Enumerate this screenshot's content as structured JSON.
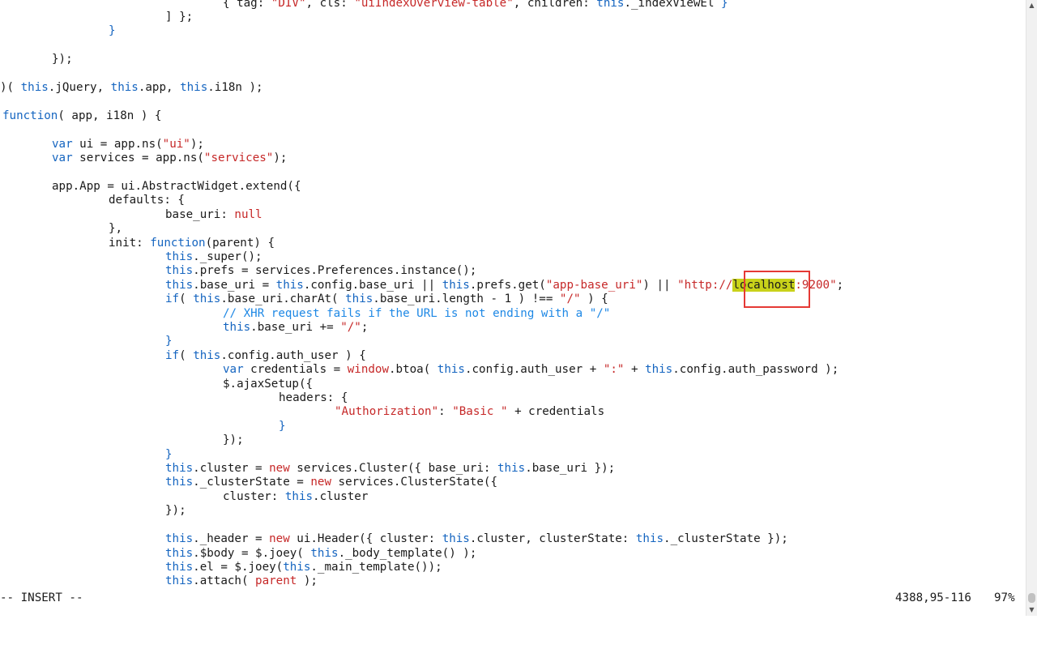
{
  "editor": {
    "lines": [
      [
        {
          "t": "{ tag: ",
          "c": "pl"
        },
        {
          "t": "\"DIV\"",
          "c": "str"
        },
        {
          "t": ", cls: ",
          "c": "pl"
        },
        {
          "t": "\"uiIndexOverview-table\"",
          "c": "str"
        },
        {
          "t": ", children: ",
          "c": "pl"
        },
        {
          "t": "this",
          "c": "kw"
        },
        {
          "t": "._indexViewEl ",
          "c": "pl"
        },
        {
          "t": "}",
          "c": "kw"
        }
      ],
      [
        {
          "t": "] };",
          "c": "pl"
        }
      ],
      [
        {
          "t": "}",
          "c": "kw"
        }
      ],
      [],
      [
        {
          "t": "});",
          "c": "pl"
        }
      ],
      [],
      [
        {
          "t": ")( ",
          "c": "pl"
        },
        {
          "t": "this",
          "c": "kw"
        },
        {
          "t": ".jQuery, ",
          "c": "pl"
        },
        {
          "t": "this",
          "c": "kw"
        },
        {
          "t": ".app, ",
          "c": "pl"
        },
        {
          "t": "this",
          "c": "kw"
        },
        {
          "t": ".i18n );",
          "c": "pl"
        }
      ],
      [],
      [
        {
          "t": "function",
          "c": "kw"
        },
        {
          "t": "( app, i18n ) {",
          "c": "pl"
        }
      ],
      [],
      [
        {
          "t": "var",
          "c": "kw"
        },
        {
          "t": " ui = app.ns(",
          "c": "pl"
        },
        {
          "t": "\"ui\"",
          "c": "str"
        },
        {
          "t": ");",
          "c": "pl"
        }
      ],
      [
        {
          "t": "var",
          "c": "kw"
        },
        {
          "t": " services = app.ns(",
          "c": "pl"
        },
        {
          "t": "\"services\"",
          "c": "str"
        },
        {
          "t": ");",
          "c": "pl"
        }
      ],
      [],
      [
        {
          "t": "app.App = ui.AbstractWidget.extend({",
          "c": "pl"
        }
      ],
      [
        {
          "t": "defaults: {",
          "c": "pl"
        }
      ],
      [
        {
          "t": "base_uri: ",
          "c": "pl"
        },
        {
          "t": "null",
          "c": "str"
        }
      ],
      [
        {
          "t": "},",
          "c": "pl"
        }
      ],
      [
        {
          "t": "init: ",
          "c": "pl"
        },
        {
          "t": "function",
          "c": "kw"
        },
        {
          "t": "(parent) {",
          "c": "pl"
        }
      ],
      [
        {
          "t": "this",
          "c": "kw"
        },
        {
          "t": "._super();",
          "c": "pl"
        }
      ],
      [
        {
          "t": "this",
          "c": "kw"
        },
        {
          "t": ".prefs = services.Preferences.instance();",
          "c": "pl"
        }
      ],
      [
        {
          "t": "this",
          "c": "kw"
        },
        {
          "t": ".base_uri = ",
          "c": "pl"
        },
        {
          "t": "this",
          "c": "kw"
        },
        {
          "t": ".config.base_uri || ",
          "c": "pl"
        },
        {
          "t": "this",
          "c": "kw"
        },
        {
          "t": ".prefs.get(",
          "c": "pl"
        },
        {
          "t": "\"app-base_uri\"",
          "c": "str"
        },
        {
          "t": ") || ",
          "c": "pl"
        },
        {
          "t": "\"http://",
          "c": "str"
        },
        {
          "t": "localhost",
          "c": "hl"
        },
        {
          "t": ":9200\"",
          "c": "str"
        },
        {
          "t": ";",
          "c": "pl"
        }
      ],
      [
        {
          "t": "if",
          "c": "kw"
        },
        {
          "t": "( ",
          "c": "pl"
        },
        {
          "t": "this",
          "c": "kw"
        },
        {
          "t": ".base_uri.charAt( ",
          "c": "pl"
        },
        {
          "t": "this",
          "c": "kw"
        },
        {
          "t": ".base_uri.length - 1 ) !== ",
          "c": "pl"
        },
        {
          "t": "\"/\"",
          "c": "str"
        },
        {
          "t": " ) {",
          "c": "pl"
        }
      ],
      [
        {
          "t": "// XHR request fails if the URL is not ending with a \"/\"",
          "c": "cm"
        }
      ],
      [
        {
          "t": "this",
          "c": "kw"
        },
        {
          "t": ".base_uri += ",
          "c": "pl"
        },
        {
          "t": "\"/\"",
          "c": "str"
        },
        {
          "t": ";",
          "c": "pl"
        }
      ],
      [
        {
          "t": "}",
          "c": "kw"
        }
      ],
      [
        {
          "t": "if",
          "c": "kw"
        },
        {
          "t": "( ",
          "c": "pl"
        },
        {
          "t": "this",
          "c": "kw"
        },
        {
          "t": ".config.auth_user ) {",
          "c": "pl"
        }
      ],
      [
        {
          "t": "var",
          "c": "kw"
        },
        {
          "t": " credentials = ",
          "c": "pl"
        },
        {
          "t": "window",
          "c": "str"
        },
        {
          "t": ".btoa( ",
          "c": "pl"
        },
        {
          "t": "this",
          "c": "kw"
        },
        {
          "t": ".config.auth_user + ",
          "c": "pl"
        },
        {
          "t": "\":\"",
          "c": "str"
        },
        {
          "t": " + ",
          "c": "pl"
        },
        {
          "t": "this",
          "c": "kw"
        },
        {
          "t": ".config.auth_password );",
          "c": "pl"
        }
      ],
      [
        {
          "t": "$.ajaxSetup({",
          "c": "pl"
        }
      ],
      [
        {
          "t": "headers: {",
          "c": "pl"
        }
      ],
      [
        {
          "t": "\"Authorization\"",
          "c": "str"
        },
        {
          "t": ": ",
          "c": "pl"
        },
        {
          "t": "\"Basic \"",
          "c": "str"
        },
        {
          "t": " + credentials",
          "c": "pl"
        }
      ],
      [
        {
          "t": "}",
          "c": "kw"
        }
      ],
      [
        {
          "t": "});",
          "c": "pl"
        }
      ],
      [
        {
          "t": "}",
          "c": "kw"
        }
      ],
      [
        {
          "t": "this",
          "c": "kw"
        },
        {
          "t": ".cluster = ",
          "c": "pl"
        },
        {
          "t": "new",
          "c": "str"
        },
        {
          "t": " services.Cluster({ base_uri: ",
          "c": "pl"
        },
        {
          "t": "this",
          "c": "kw"
        },
        {
          "t": ".base_uri });",
          "c": "pl"
        }
      ],
      [
        {
          "t": "this",
          "c": "kw"
        },
        {
          "t": "._clusterState = ",
          "c": "pl"
        },
        {
          "t": "new",
          "c": "str"
        },
        {
          "t": " services.ClusterState({",
          "c": "pl"
        }
      ],
      [
        {
          "t": "cluster: ",
          "c": "pl"
        },
        {
          "t": "this",
          "c": "kw"
        },
        {
          "t": ".cluster",
          "c": "pl"
        }
      ],
      [
        {
          "t": "});",
          "c": "pl"
        }
      ],
      [],
      [
        {
          "t": "this",
          "c": "kw"
        },
        {
          "t": "._header = ",
          "c": "pl"
        },
        {
          "t": "new",
          "c": "str"
        },
        {
          "t": " ui.Header({ cluster: ",
          "c": "pl"
        },
        {
          "t": "this",
          "c": "kw"
        },
        {
          "t": ".cluster, clusterState: ",
          "c": "pl"
        },
        {
          "t": "this",
          "c": "kw"
        },
        {
          "t": "._clusterState });",
          "c": "pl"
        }
      ],
      [
        {
          "t": "this",
          "c": "kw"
        },
        {
          "t": ".$body = $.joey( ",
          "c": "pl"
        },
        {
          "t": "this",
          "c": "kw"
        },
        {
          "t": "._body_template() );",
          "c": "pl"
        }
      ],
      [
        {
          "t": "this",
          "c": "kw"
        },
        {
          "t": ".el = $.joey(",
          "c": "pl"
        },
        {
          "t": "this",
          "c": "kw"
        },
        {
          "t": "._main_template());",
          "c": "pl"
        }
      ],
      [
        {
          "t": "this",
          "c": "kw"
        },
        {
          "t": ".attach( ",
          "c": "pl"
        },
        {
          "t": "parent",
          "c": "str"
        },
        {
          "t": " );",
          "c": "pl"
        }
      ]
    ]
  },
  "status": {
    "mode": "-- INSERT --",
    "position": "4388,95-116",
    "percent": "97%"
  },
  "colors": {
    "keyword": "#1565c0",
    "string": "#c62828",
    "comment": "#1e88e5",
    "highlight": "#c9d21a",
    "annotation_box": "#e53935"
  }
}
